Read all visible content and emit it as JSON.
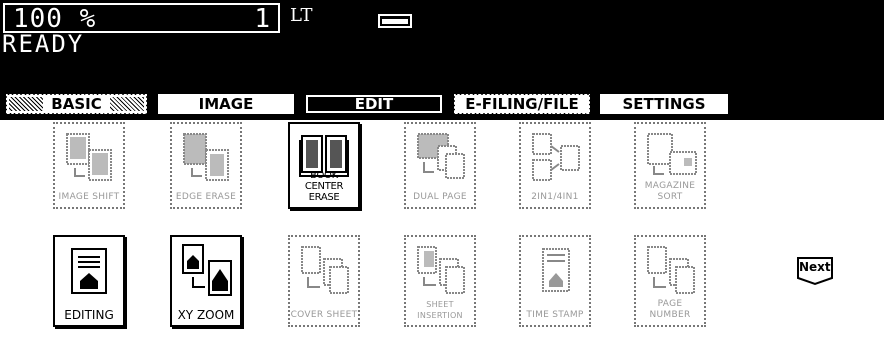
{
  "status": {
    "zoom": "100  %",
    "count": "1",
    "paper_size": "LT",
    "message": "READY"
  },
  "tabs": [
    {
      "label": "BASIC"
    },
    {
      "label": "IMAGE"
    },
    {
      "label": "EDIT"
    },
    {
      "label": "E-FILING/FILE"
    },
    {
      "label": "SETTINGS"
    }
  ],
  "functions_row1": [
    {
      "label": "IMAGE SHIFT",
      "icon": "image-shift-icon"
    },
    {
      "label": "EDGE ERASE",
      "icon": "edge-erase-icon"
    },
    {
      "label": "BOOK CENTER ERASE",
      "icon": "book-center-erase-icon"
    },
    {
      "label": "DUAL PAGE",
      "icon": "dual-page-icon"
    },
    {
      "label": "2IN1/4IN1",
      "icon": "2in1-4in1-icon"
    },
    {
      "label": "MAGAZINE SORT",
      "icon": "magazine-sort-icon"
    }
  ],
  "functions_row2": [
    {
      "label": "EDITING",
      "icon": "editing-icon"
    },
    {
      "label": "XY ZOOM",
      "icon": "xy-zoom-icon"
    },
    {
      "label": "COVER SHEET",
      "icon": "cover-sheet-icon"
    },
    {
      "label": "SHEET INSERTION",
      "icon": "sheet-insertion-icon"
    },
    {
      "label": "TIME STAMP",
      "icon": "time-stamp-icon"
    },
    {
      "label": "PAGE NUMBER",
      "icon": "page-number-icon"
    }
  ],
  "next_button": "Next"
}
